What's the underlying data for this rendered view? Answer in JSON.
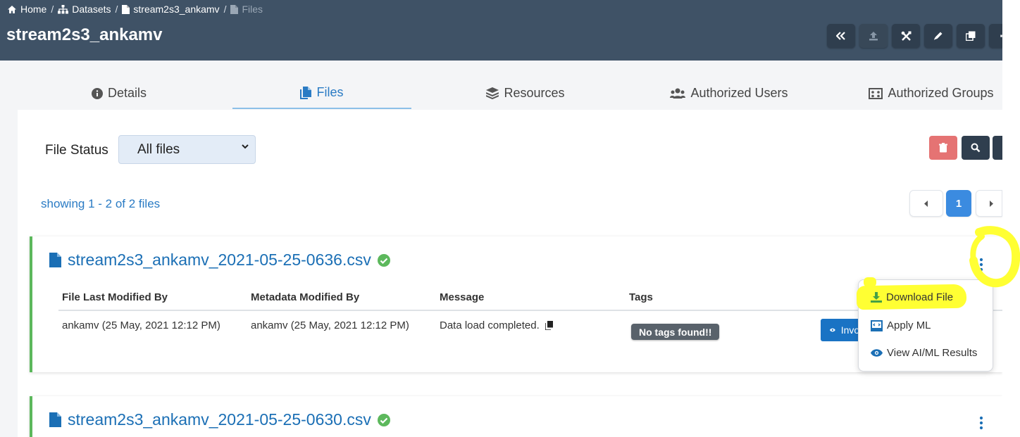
{
  "breadcrumb": [
    {
      "label": "Home",
      "icon": "home-icon"
    },
    {
      "label": "Datasets",
      "icon": "sitemap-icon"
    },
    {
      "label": "stream2s3_ankamv",
      "icon": "file-icon"
    },
    {
      "label": "Files",
      "icon": "file-icon"
    }
  ],
  "breadcrumb_separator": "/",
  "page_title": "stream2s3_ankamv",
  "header_actions": [
    "collapse-icon",
    "upload-icon",
    "tools-icon",
    "edit-icon",
    "copy-icon",
    "delete-icon"
  ],
  "tabs": [
    {
      "label": "Details",
      "icon": "info-circle-icon"
    },
    {
      "label": "Files",
      "icon": "files-icon",
      "active": true
    },
    {
      "label": "Resources",
      "icon": "layers-icon"
    },
    {
      "label": "Authorized Users",
      "icon": "users-icon"
    },
    {
      "label": "Authorized Groups",
      "icon": "groups-icon"
    }
  ],
  "filter": {
    "label": "File Status",
    "selected": "All files"
  },
  "showing": "showing 1 - 2 of 2 files",
  "pagination": {
    "current": "1"
  },
  "columns": [
    "File Last Modified By",
    "Metadata Modified By",
    "Message",
    "Tags"
  ],
  "files": [
    {
      "name": "stream2s3_ankamv_2021-05-25-0636.csv",
      "file_modified": "ankamv (25 May, 2021 12:12 PM)",
      "metadata_modified": "ankamv (25 May, 2021 12:12 PM)",
      "message": "Data load completed.",
      "tags": "No tags found!!",
      "action_label": "Invoke"
    },
    {
      "name": "stream2s3_ankamv_2021-05-25-0630.csv"
    }
  ],
  "menu": [
    {
      "label": "Download File",
      "icon": "download-icon"
    },
    {
      "label": "Apply ML",
      "icon": "ml-icon"
    },
    {
      "label": "View AI/ML Results",
      "icon": "eye-icon"
    }
  ],
  "colors": {
    "header_bg": "#3f5266",
    "link": "#2a7bc4",
    "success": "#5cb85c",
    "danger_button": "#e57373",
    "primary_button": "#1a73c4",
    "highlight": "#ffff33"
  }
}
